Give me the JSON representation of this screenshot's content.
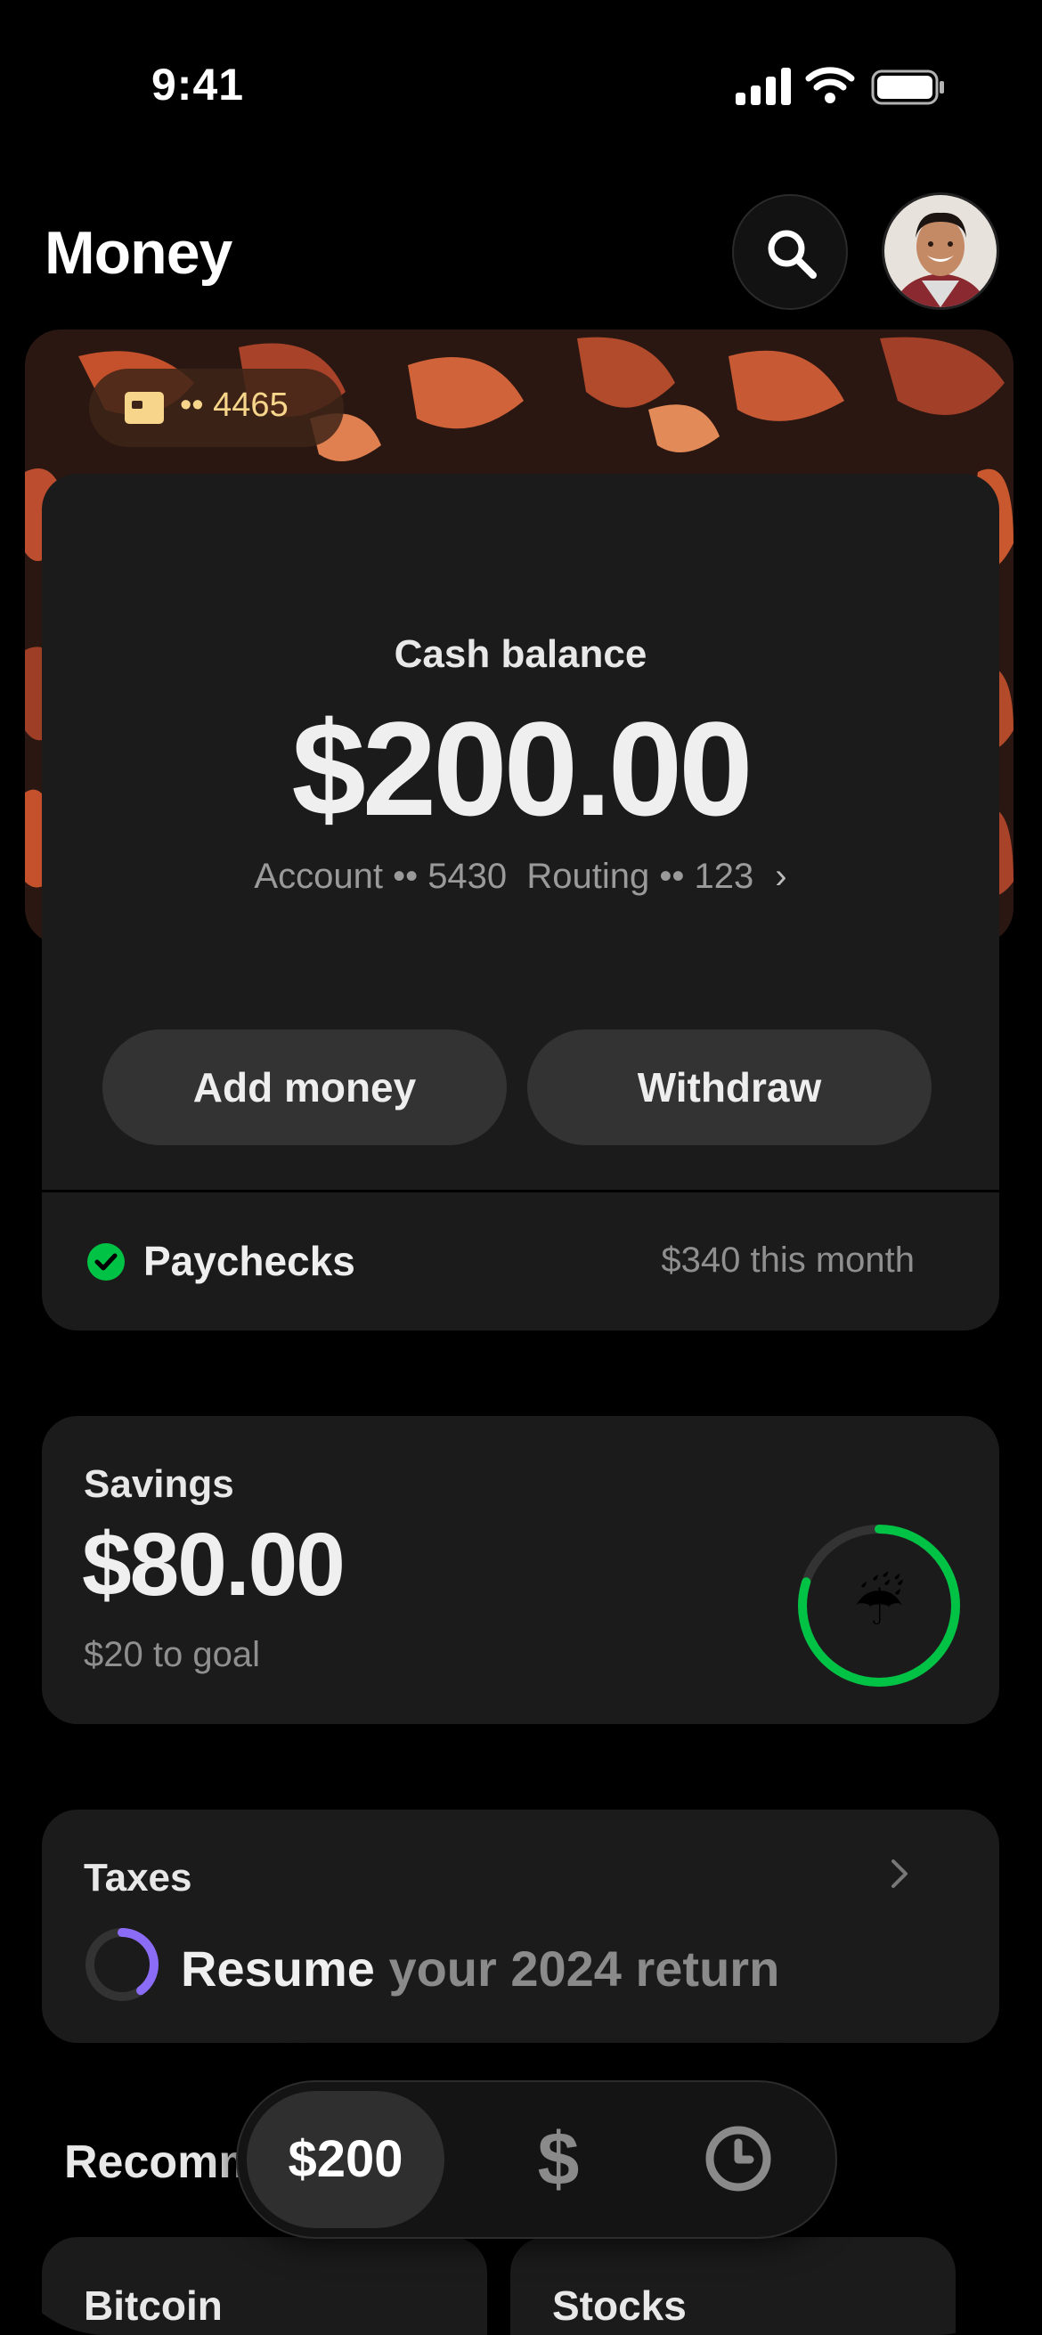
{
  "status_bar": {
    "time": "9:41"
  },
  "header": {
    "title": "Money"
  },
  "card": {
    "number": "•• 4465"
  },
  "cash": {
    "label": "Cash balance",
    "amount": "$200.00",
    "account": "Account •• 5430",
    "routing": "Routing •• 123",
    "add_money": "Add money",
    "withdraw": "Withdraw",
    "paychecks_label": "Paychecks",
    "paychecks_value": "$340 this month"
  },
  "savings": {
    "label": "Savings",
    "amount": "$80.00",
    "goal": "$20 to goal",
    "goal_progress": 0.8,
    "emoji": "☔"
  },
  "taxes": {
    "label": "Taxes",
    "action": "Resume",
    "rest": "your 2024 return",
    "progress": 0.4
  },
  "recommended": {
    "label": "Recomm"
  },
  "bottom_cards": [
    "Bitcoin",
    "Stocks"
  ],
  "dock": {
    "balance": "$200",
    "dollar": "$"
  },
  "colors": {
    "accent_green": "#00c244",
    "purple": "#8b6cf6",
    "card_gold": "#f7d58b"
  }
}
